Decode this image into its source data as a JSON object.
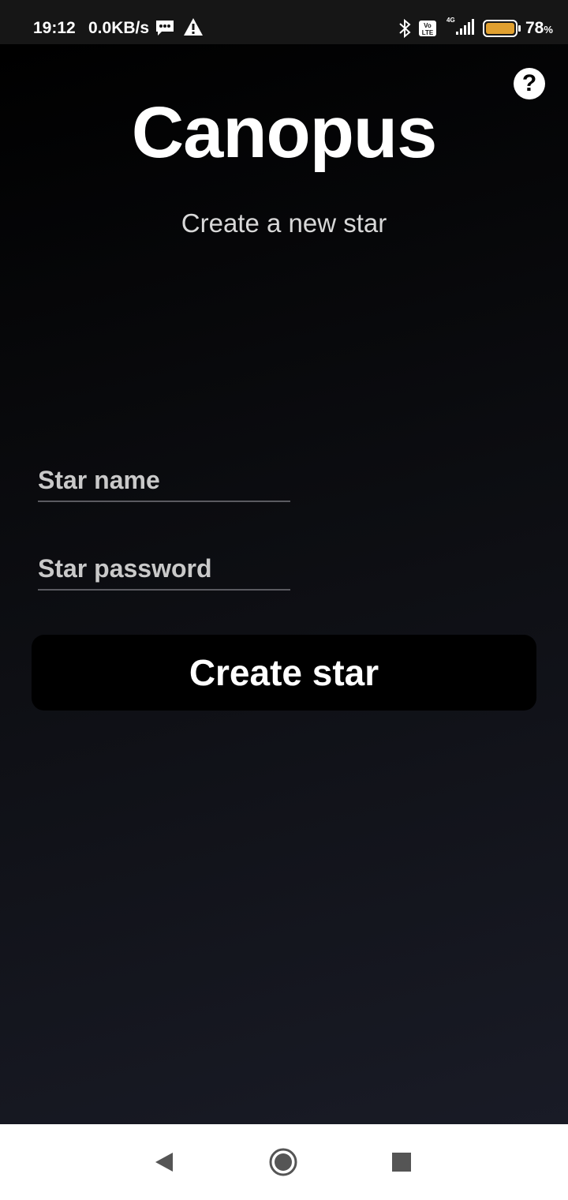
{
  "status_bar": {
    "time": "19:12",
    "net_speed": "0.0KB/s",
    "network": "4G",
    "volte": "Vo LTE",
    "battery_percent": "78",
    "battery_unit": "%",
    "battery_level": 0.78,
    "icons": [
      "message-icon",
      "alert-icon",
      "bluetooth-icon",
      "volte-icon",
      "signal-icon",
      "battery-icon"
    ]
  },
  "app": {
    "title": "Canopus",
    "subtitle": "Create a new star",
    "help_label": "?",
    "form": {
      "star_name": {
        "value": "",
        "placeholder": "Star name"
      },
      "star_password": {
        "value": "",
        "placeholder": "Star password"
      },
      "submit_label": "Create star"
    }
  },
  "nav_bar": {
    "icons": [
      "back-icon",
      "home-icon",
      "recents-icon"
    ]
  },
  "colors": {
    "background_top": "#000000",
    "background_bottom": "#191b26",
    "button": "#000000",
    "text": "#ffffff",
    "nav_bar": "#ffffff",
    "nav_icons": "#555555",
    "battery": "#e0a030"
  }
}
